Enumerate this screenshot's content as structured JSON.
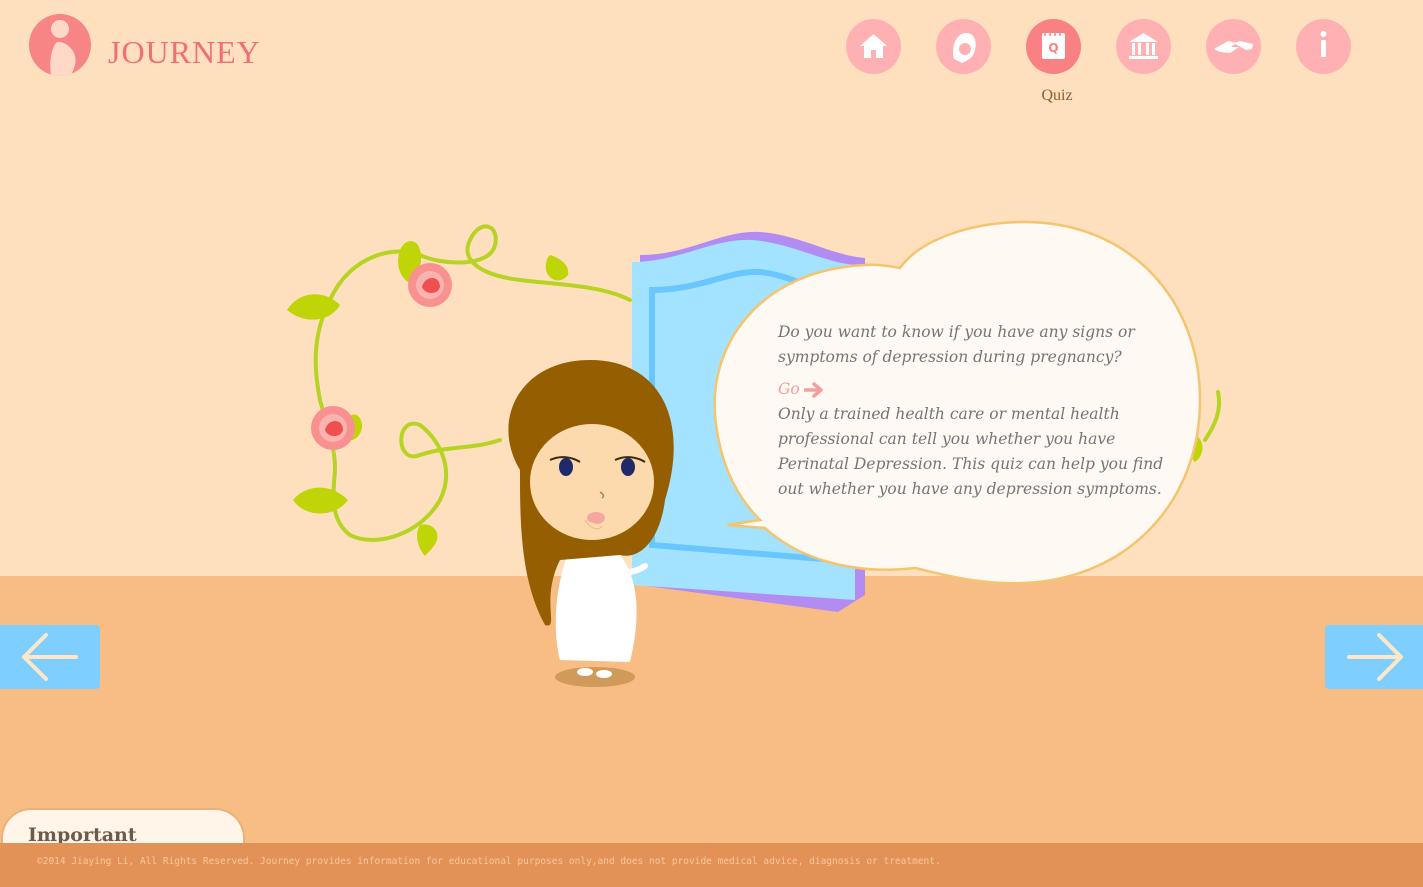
{
  "header": {
    "brand": "JOURNEY",
    "nav": [
      {
        "name": "home",
        "icon": "house-icon"
      },
      {
        "name": "mother",
        "icon": "mother-face-icon"
      },
      {
        "name": "quiz",
        "icon": "quiz-notepad-icon",
        "label": "Quiz",
        "active": true
      },
      {
        "name": "resources",
        "icon": "institution-icon"
      },
      {
        "name": "support",
        "icon": "helping-hands-icon"
      },
      {
        "name": "info",
        "icon": "info-icon"
      }
    ]
  },
  "bubble": {
    "question": "Do you want to know if you have any signs or symptoms of depression during pregnancy?",
    "go_label": "Go",
    "disclaimer": "Only a trained health care or mental health professional can tell you whether you have Perinatal Depression. This quiz can help you find out whether you have any depression symptoms."
  },
  "navigation": {
    "prev_icon": "arrow-left-icon",
    "next_icon": "arrow-right-icon"
  },
  "important_tab": "Important",
  "footer": {
    "text": "©2014 Jiaying Li, All Rights Reserved. Journey provides information for educational purposes only,and does not provide medical advice, diagnosis or treatment."
  },
  "colors": {
    "background": "#fee0bf",
    "floor": "#f7bd84",
    "accent_pink": "#f98183",
    "nav_arrow_blue": "#7ecfff",
    "footer": "#e39257"
  }
}
